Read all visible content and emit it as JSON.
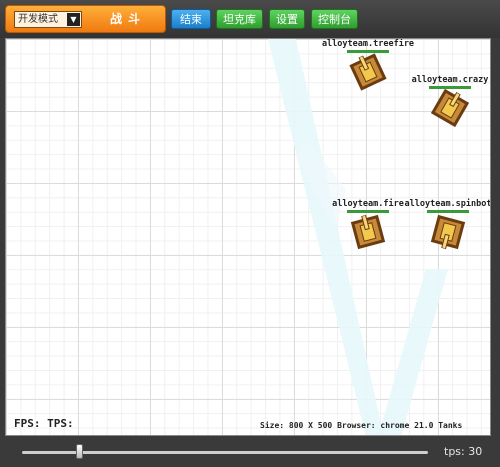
{
  "toolbar": {
    "mode_selected": "开发模式",
    "fight_label": "战斗",
    "end_label": "结束",
    "tanks_label": "坦克库",
    "settings_label": "设置",
    "console_label": "控制台"
  },
  "arena": {
    "tanks": [
      {
        "name": "alloyteam.treefire"
      },
      {
        "name": "alloyteam.crazy"
      },
      {
        "name": "alloyteam.fire"
      },
      {
        "name": "alloyteam.spinbot"
      }
    ],
    "fps_text": "FPS: TPS:",
    "status_text": "Size: 800 X 500   Browser: chrome 21.0   Tanks"
  },
  "bottombar": {
    "speed_fraction": 0.14,
    "tps_text": "tps: 30"
  },
  "colors": {
    "accent_orange": "#f39a1e",
    "button_blue": "#2b8fdb",
    "button_green": "#3cb33c",
    "health_green": "#3a9a3a"
  }
}
